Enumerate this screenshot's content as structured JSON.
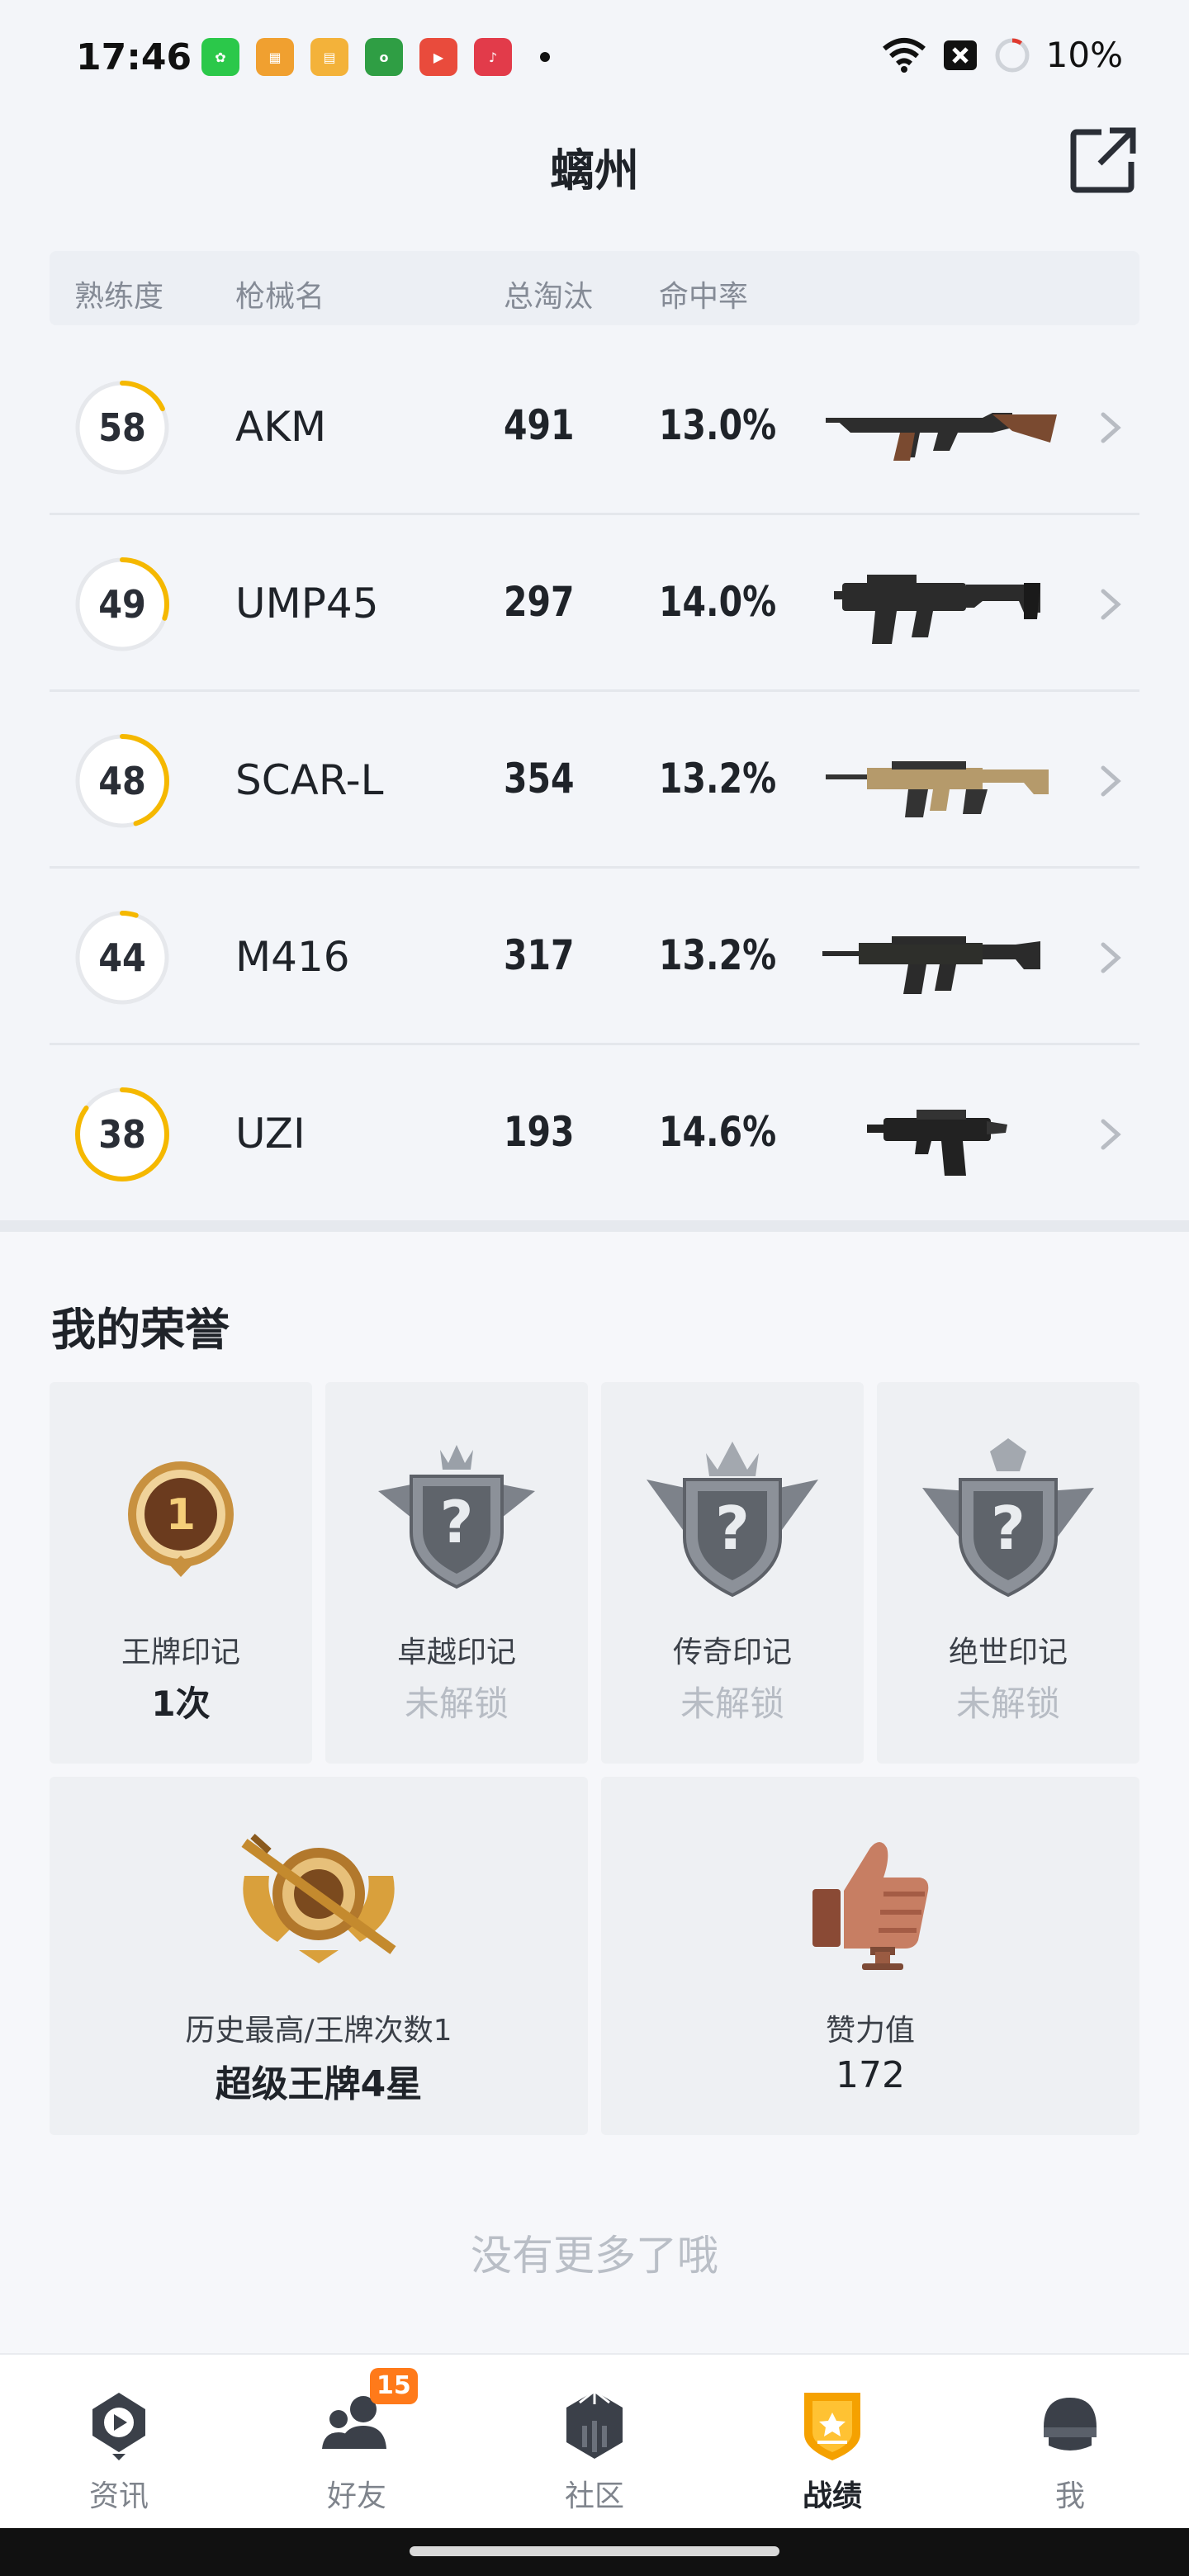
{
  "status_bar": {
    "time": "17:46",
    "battery_text": "10%",
    "app_icons": [
      "wechat-icon",
      "app-icon",
      "app-icon",
      "oppo-icon",
      "video-icon",
      "music-icon"
    ]
  },
  "header": {
    "title": "螭州"
  },
  "table": {
    "headers": {
      "mastery": "熟练度",
      "gun": "枪械名",
      "kills": "总淘汰",
      "accuracy": "命中率"
    },
    "rows": [
      {
        "mastery": "58",
        "mastery_progress": 0.18,
        "name": "AKM",
        "kills": "491",
        "accuracy": "13.0%",
        "icon": "akm-icon"
      },
      {
        "mastery": "49",
        "mastery_progress": 0.3,
        "name": "UMP45",
        "kills": "297",
        "accuracy": "14.0%",
        "icon": "ump45-icon"
      },
      {
        "mastery": "48",
        "mastery_progress": 0.45,
        "name": "SCAR-L",
        "kills": "354",
        "accuracy": "13.2%",
        "icon": "scar-l-icon"
      },
      {
        "mastery": "44",
        "mastery_progress": 0.05,
        "name": "M416",
        "kills": "317",
        "accuracy": "13.2%",
        "icon": "m416-icon"
      },
      {
        "mastery": "38",
        "mastery_progress": 0.85,
        "name": "UZI",
        "kills": "193",
        "accuracy": "14.6%",
        "icon": "uzi-icon"
      }
    ]
  },
  "honor": {
    "title": "我的荣誉",
    "marks": [
      {
        "label": "王牌印记",
        "value": "1次",
        "locked": false
      },
      {
        "label": "卓越印记",
        "value": "未解锁",
        "locked": true
      },
      {
        "label": "传奇印记",
        "value": "未解锁",
        "locked": true
      },
      {
        "label": "绝世印记",
        "value": "未解锁",
        "locked": true
      }
    ],
    "rank": {
      "label": "历史最高/王牌次数1",
      "value": "超级王牌4星"
    },
    "likes": {
      "label": "赞力值",
      "value": "172"
    }
  },
  "footer": {
    "no_more": "没有更多了哦"
  },
  "bottom_nav": {
    "items": [
      {
        "label": "资讯",
        "icon": "news-icon"
      },
      {
        "label": "好友",
        "icon": "friends-icon",
        "badge": "15"
      },
      {
        "label": "社区",
        "icon": "community-icon"
      },
      {
        "label": "战绩",
        "icon": "stats-icon",
        "active": true
      },
      {
        "label": "我",
        "icon": "profile-icon"
      }
    ]
  },
  "colors": {
    "accent": "#f5b800",
    "ring_track": "#e6e8ec",
    "badge": "#ff7a1a"
  }
}
